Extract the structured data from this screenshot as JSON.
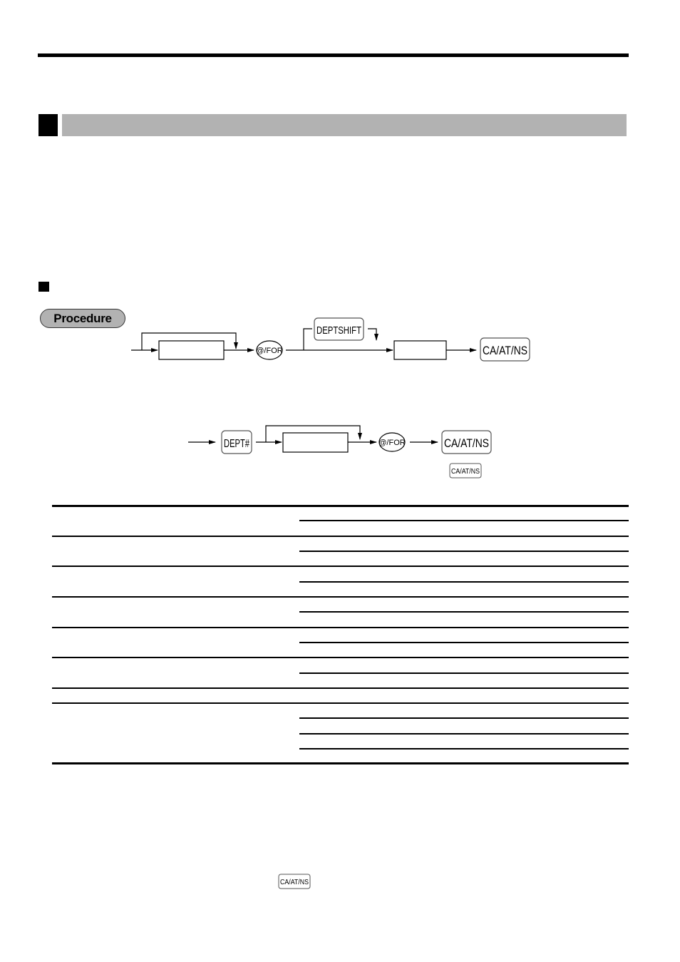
{
  "page": {
    "section_heading": "",
    "subsection_heading": "",
    "procedure_label": "Procedure"
  },
  "diagram_1": {
    "keys": {
      "for_key": "@/FOR",
      "deptshift_key": "DEPTSHIFT",
      "finalize_key": "CA/AT/NS"
    },
    "input_boxes": [
      "",
      ""
    ]
  },
  "diagram_2": {
    "keys": {
      "dept_key": "DEPT#",
      "for_key": "@/FOR",
      "finalize_key": "CA/AT/NS",
      "finalize_key_small": "CA/AT/NS"
    },
    "input_boxes": [
      ""
    ]
  },
  "table": {
    "rows": [
      {
        "label": "",
        "sub_items": [
          "",
          ""
        ]
      },
      {
        "label": "",
        "sub_items": [
          "",
          ""
        ]
      },
      {
        "label": "",
        "sub_items": [
          "",
          ""
        ]
      },
      {
        "label": "",
        "sub_items": [
          "",
          ""
        ]
      },
      {
        "label": "",
        "sub_items": [
          "",
          ""
        ]
      },
      {
        "label": "",
        "sub_items": [
          "",
          ""
        ]
      },
      {
        "label": "",
        "sub_items": [
          ""
        ]
      },
      {
        "label": "",
        "sub_items": [
          "",
          "",
          "",
          ""
        ]
      }
    ]
  },
  "footer_note": {
    "inline_key": "CA/AT/NS"
  }
}
